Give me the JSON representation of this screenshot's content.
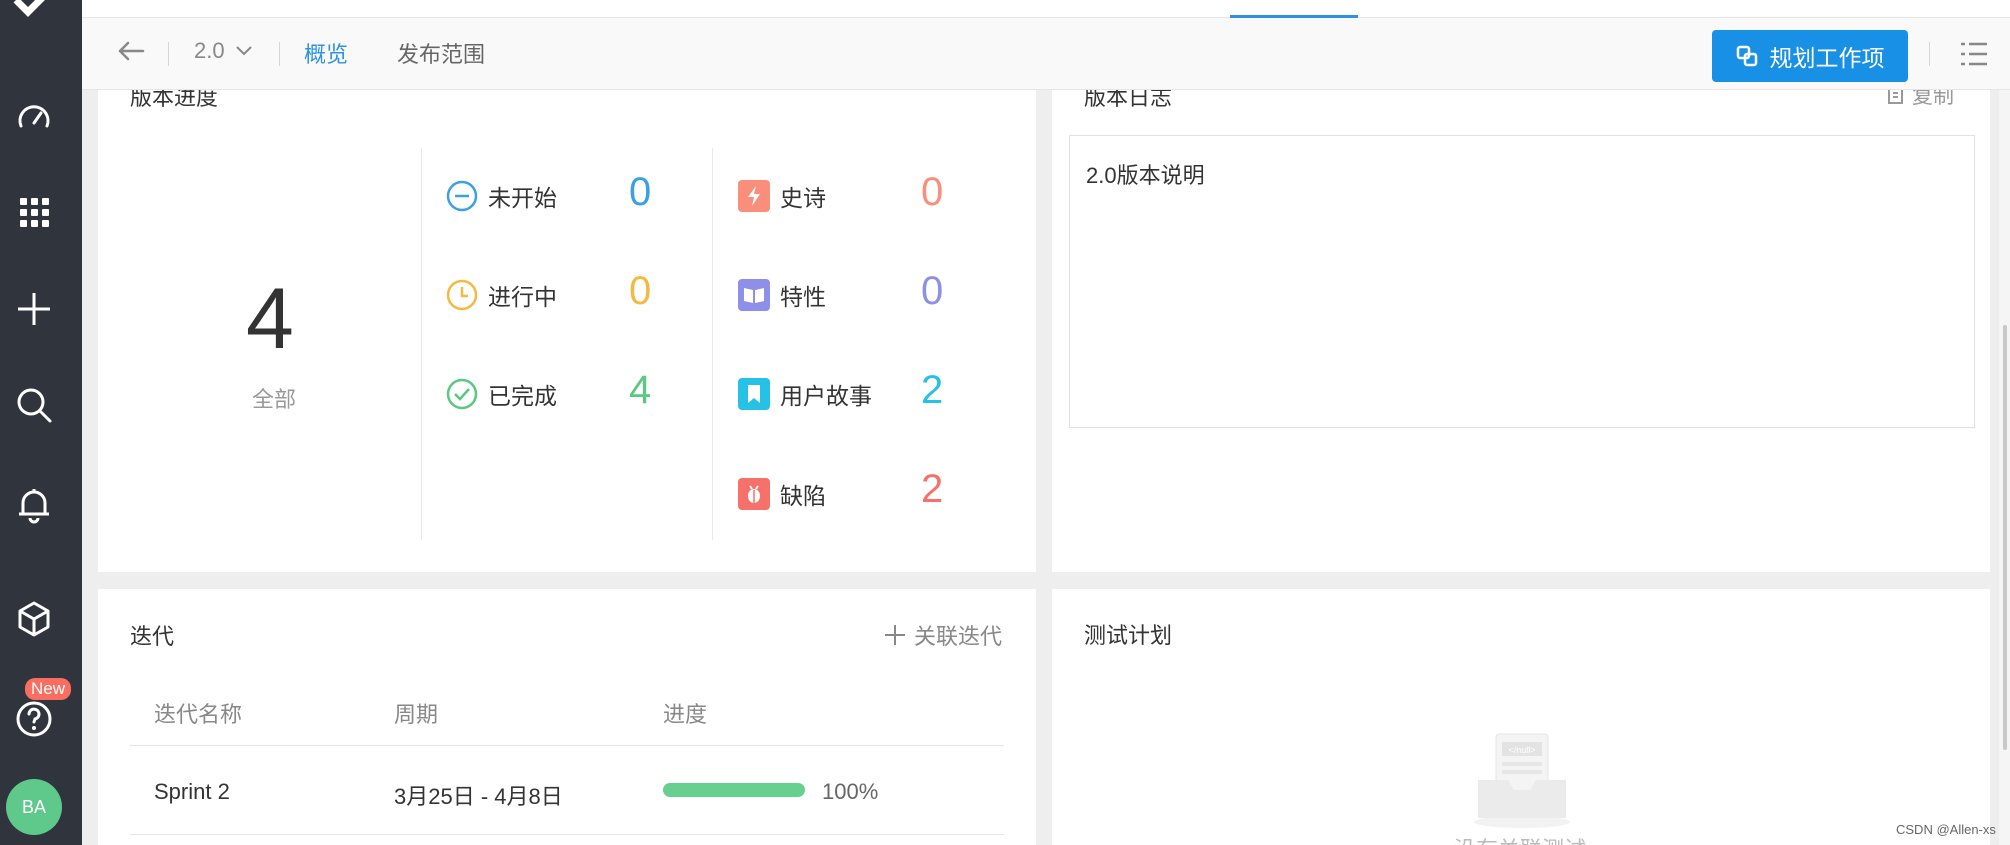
{
  "header": {
    "version": "2.0",
    "tabs": [
      {
        "label": "概览",
        "active": true
      },
      {
        "label": "发布范围",
        "active": false
      }
    ],
    "primary_button": "规划工作项"
  },
  "sidebar": {
    "items": [
      "dashboard-icon",
      "apps-icon",
      "add-icon",
      "search-icon",
      "bell-icon",
      "product-icon",
      "help-icon"
    ],
    "new_badge": "New",
    "avatar": "BA"
  },
  "progress_panel": {
    "title": "版本进度",
    "total": "4",
    "total_label": "全部",
    "status": [
      {
        "label": "未开始",
        "count": "0",
        "color": "#3aa0e6"
      },
      {
        "label": "进行中",
        "count": "0",
        "color": "#f5b942"
      },
      {
        "label": "已完成",
        "count": "4",
        "color": "#5ac87e"
      }
    ],
    "types": [
      {
        "label": "史诗",
        "count": "0",
        "color": "#fa8e7c"
      },
      {
        "label": "特性",
        "count": "0",
        "color": "#8d8fe8"
      },
      {
        "label": "用户故事",
        "count": "2",
        "color": "#26c1e6"
      },
      {
        "label": "缺陷",
        "count": "2",
        "color": "#f7716b"
      }
    ]
  },
  "log_panel": {
    "title": "版本日志",
    "copy": "复制",
    "text": "2.0版本说明"
  },
  "iteration_panel": {
    "title": "迭代",
    "link": "关联迭代",
    "columns": [
      "迭代名称",
      "周期",
      "进度"
    ],
    "rows": [
      {
        "name": "Sprint 2",
        "period": "3月25日 - 4月8日",
        "progress": 1.0,
        "progress_text": "100%"
      }
    ]
  },
  "test_panel": {
    "title": "测试计划",
    "empty_image_text": "</null>",
    "empty_text": "没有关联测试"
  },
  "watermark": "CSDN @Allen-xs",
  "colors": {
    "accent": "#1790e6",
    "nav_bg": "#2f343d"
  }
}
